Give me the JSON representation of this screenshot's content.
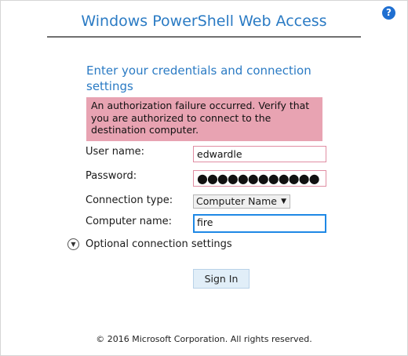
{
  "header": {
    "title": "Windows PowerShell Web Access",
    "help_icon": "question-mark-icon",
    "help_glyph": "?"
  },
  "form": {
    "subtitle": "Enter your credentials and connection settings",
    "error_message": "An authorization failure occurred. Verify that you are authorized to connect to the destination computer.",
    "user_name_label": "User name:",
    "user_name_value": "edwardle",
    "password_label": "Password:",
    "password_value": "●●●●●●●●●●●●",
    "connection_type_label": "Connection type:",
    "connection_type_value": "Computer Name",
    "computer_name_label": "Computer name:",
    "computer_name_value": "fire",
    "optional_settings_label": "Optional connection settings",
    "sign_in_label": "Sign In"
  },
  "footer": {
    "copyright": "© 2016 Microsoft Corporation. All rights reserved."
  },
  "colors": {
    "title": "#2b7bc4",
    "error_background": "#e8a3b2",
    "invalid_field_border": "#e08ea3",
    "focus_border": "#1e88e5",
    "button_background": "#e1eef8"
  }
}
